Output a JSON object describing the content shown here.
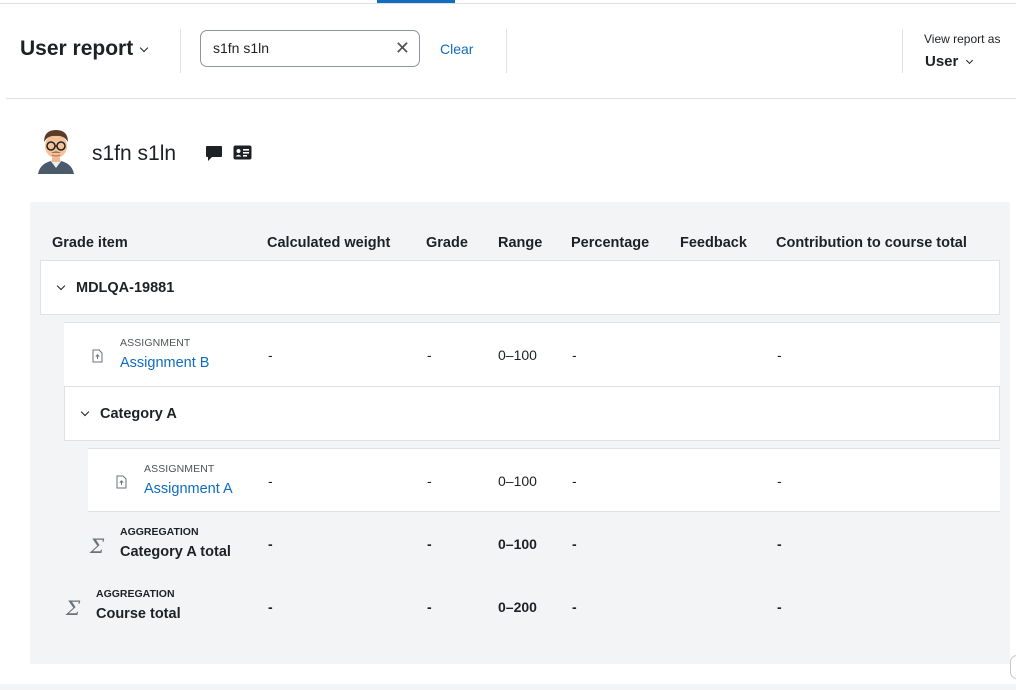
{
  "header": {
    "report_title": "User report",
    "search": {
      "value": "s1fn s1ln",
      "placeholder": ""
    },
    "clear_label": "Clear",
    "view_as_label": "View report as",
    "view_as_value": "User"
  },
  "user": {
    "name": "s1fn s1ln"
  },
  "icons": {
    "message": "speech-bubble-icon",
    "profile": "id-card-icon",
    "assignment": "assignment-file-icon",
    "aggregation": "sigma-icon"
  },
  "colors": {
    "link": "#0f6cbf",
    "panel_bg": "#f3f4f6",
    "text": "#1d2125"
  },
  "table": {
    "columns": [
      "Grade item",
      "Calculated weight",
      "Grade",
      "Range",
      "Percentage",
      "Feedback",
      "Contribution to course total"
    ],
    "category_top": {
      "name": "MDLQA-19881"
    },
    "assignment_b": {
      "type": "ASSIGNMENT",
      "name": "Assignment B",
      "weight": "-",
      "grade": "-",
      "range": "0–100",
      "percentage": "-",
      "feedback": "",
      "contribution": "-"
    },
    "category_a": {
      "name": "Category A"
    },
    "assignment_a": {
      "type": "ASSIGNMENT",
      "name": "Assignment A",
      "weight": "-",
      "grade": "-",
      "range": "0–100",
      "percentage": "-",
      "feedback": "",
      "contribution": "-"
    },
    "category_a_total": {
      "type": "AGGREGATION",
      "name": "Category A total",
      "weight": "-",
      "grade": "-",
      "range": "0–100",
      "percentage": "-",
      "feedback": "",
      "contribution": "-"
    },
    "course_total": {
      "type": "AGGREGATION",
      "name": "Course total",
      "weight": "-",
      "grade": "-",
      "range": "0–200",
      "percentage": "-",
      "feedback": "",
      "contribution": "-"
    }
  }
}
